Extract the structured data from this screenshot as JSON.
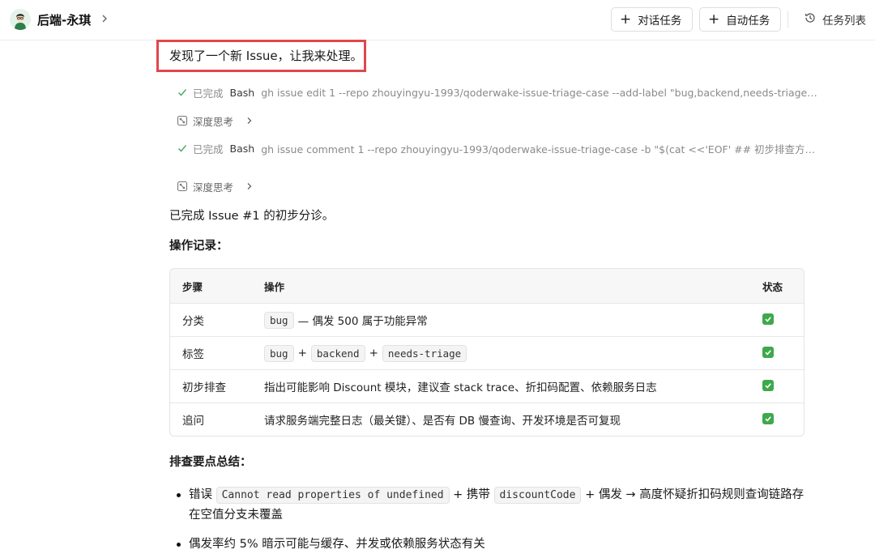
{
  "header": {
    "title": "后端-永琪",
    "chat_task_label": "对话任务",
    "auto_task_label": "自动任务",
    "task_list_label": "任务列表"
  },
  "highlight": {
    "text": "发现了一个新 Issue，让我来处理。",
    "box_color": "#e0474c"
  },
  "steps": [
    {
      "status": "已完成",
      "tool": "Bash",
      "command": "gh issue edit 1 --repo zhouyingyu-1993/qoderwake-issue-triage-case --add-label \"bug,backend,needs-triage…"
    },
    {
      "label": "深度思考"
    },
    {
      "status": "已完成",
      "tool": "Bash",
      "command": "gh issue comment 1 --repo zhouyingyu-1993/qoderwake-issue-triage-case -b \"$(cat <<'EOF' ## 初步排查方…"
    },
    {
      "label": "深度思考"
    }
  ],
  "summary": "已完成 Issue #1 的初步分诊。",
  "ops_heading": "操作记录：",
  "table": {
    "headers": [
      "步骤",
      "操作",
      "状态"
    ],
    "rows": [
      {
        "step": "分类",
        "codes": [
          "bug"
        ],
        "desc": "— 偶发 500 属于功能异常",
        "status": "✅"
      },
      {
        "step": "标签",
        "codes": [
          "bug",
          "backend",
          "needs-triage"
        ],
        "join": "+",
        "status": "✅"
      },
      {
        "step": "初步排查",
        "desc": "指出可能影响 Discount 模块，建议查 stack trace、折扣码配置、依赖服务日志",
        "status": "✅"
      },
      {
        "step": "追问",
        "desc": "请求服务端完整日志（最关键）、是否有 DB 慢查询、开发环境是否可复现",
        "status": "✅"
      }
    ]
  },
  "points_heading": "排查要点总结：",
  "bullets": [
    {
      "pre": "错误",
      "code1": "Cannot read properties of undefined",
      "mid": "+ 携带",
      "code2": "discountCode",
      "post": "+ 偶发 → 高度怀疑折扣码规则查询链路存",
      "line2": "在空值分支未覆盖"
    },
    {
      "text": "偶发率约 5% 暗示可能与缓存、并发或依赖服务状态有关"
    }
  ],
  "colors": {
    "accent_check": "#3ea94c",
    "border": "#e4e4e4",
    "muted_text": "#8a8a8a"
  }
}
